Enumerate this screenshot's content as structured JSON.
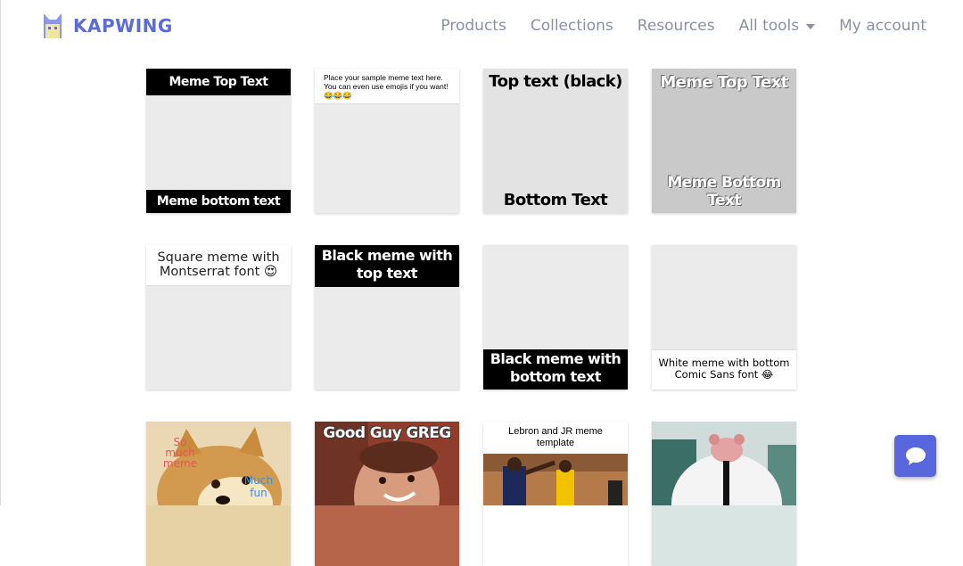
{
  "brand": {
    "name": "KAPWING"
  },
  "nav": {
    "products": "Products",
    "collections": "Collections",
    "resources": "Resources",
    "all_tools": "All tools",
    "my_account": "My account"
  },
  "templates": {
    "t1": {
      "top": "Meme Top Text",
      "bottom": "Meme bottom text"
    },
    "t2": {
      "text": "Place your sample meme text here. You can even use emojis if you want! 😂😂😂"
    },
    "t3": {
      "top": "Top text (black)",
      "bottom": "Bottom Text"
    },
    "t4": {
      "top": "Meme Top Text",
      "bottom": "Meme Bottom Text"
    },
    "t5": {
      "text": "Square meme with Montserrat font 😍"
    },
    "t6": {
      "top": "Black meme with top text"
    },
    "t7": {
      "bottom": "Black meme with bottom text"
    },
    "t8": {
      "bottom": "White meme with bottom Comic Sans font 😂"
    },
    "t9": {
      "text_a": "So much meme",
      "text_b": "Much fun"
    },
    "t10": {
      "top": "Good Guy GREG"
    },
    "t11": {
      "caption": "Lebron and JR meme template"
    },
    "t12": {}
  },
  "colors": {
    "brand": "#5c6bdb",
    "nav_text": "#8a8fa8",
    "chat_button": "#5867dd"
  },
  "icons": {
    "logo": "cat-logo-icon",
    "chat": "chat-bubble-icon",
    "dropdown": "caret-down-icon"
  }
}
